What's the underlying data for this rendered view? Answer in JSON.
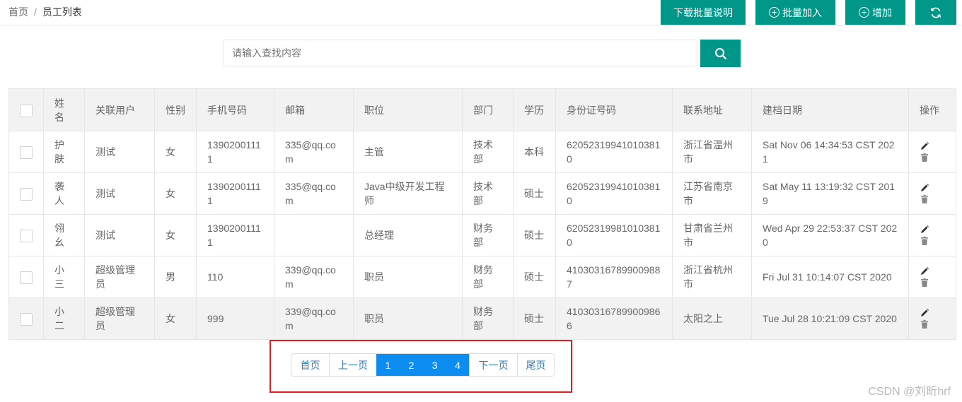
{
  "breadcrumb": {
    "home": "首页",
    "separator": "/",
    "current": "员工列表"
  },
  "toolbar": {
    "batch_help": "下载批量说明",
    "batch_add": "批量加入",
    "add": "增加",
    "refresh_icon": "refresh-icon"
  },
  "search": {
    "placeholder": "请输入查找内容",
    "value": "",
    "icon": "search-icon"
  },
  "table": {
    "headers": [
      "姓名",
      "关联用户",
      "性别",
      "手机号码",
      "邮箱",
      "职位",
      "部门",
      "学历",
      "身份证号码",
      "联系地址",
      "建档日期",
      "操作"
    ],
    "rows": [
      [
        "护肤",
        "测试",
        "女",
        "13902001111",
        "335@qq.com",
        "主管",
        "技术部",
        "本科",
        "620523199410103810",
        "浙江省温州市",
        "Sat Nov 06 14:34:53 CST 2021"
      ],
      [
        "袭人",
        "测试",
        "女",
        "13902001111",
        "335@qq.com",
        "Java中级开发工程师",
        "技术部",
        "硕士",
        "620523199410103810",
        "江苏省南京市",
        "Sat May 11 13:19:32 CST 2019"
      ],
      [
        "翎幺",
        "测试",
        "女",
        "13902001111",
        "",
        "总经理",
        "财务部",
        "硕士",
        "620523199810103810",
        "甘肃省兰州市",
        "Wed Apr 29 22:53:37 CST 2020"
      ],
      [
        "小三",
        "超级管理员",
        "男",
        "110",
        "339@qq.com",
        "职员",
        "财务部",
        "硕士",
        "410303167899009887",
        "浙江省杭州市",
        "Fri Jul 31 10:14:07 CST 2020"
      ],
      [
        "小二",
        "超级管理员",
        "女",
        "999",
        "339@qq.com",
        "职员",
        "财务部",
        "硕士",
        "410303167899009866",
        "太阳之上",
        "Tue Jul 28 10:21:09 CST 2020"
      ]
    ],
    "row_actions": [
      "edit-icon",
      "delete-icon"
    ]
  },
  "pagination": {
    "first": "首页",
    "prev": "上一页",
    "pages": [
      "1",
      "2",
      "3",
      "4"
    ],
    "next": "下一页",
    "last": "尾页"
  },
  "watermark": "CSDN @刘昕hrf",
  "colors": {
    "primary": "#009688",
    "page_active": "#0d8cf2",
    "link": "#337ab7",
    "highlight_frame": "#e02020"
  }
}
